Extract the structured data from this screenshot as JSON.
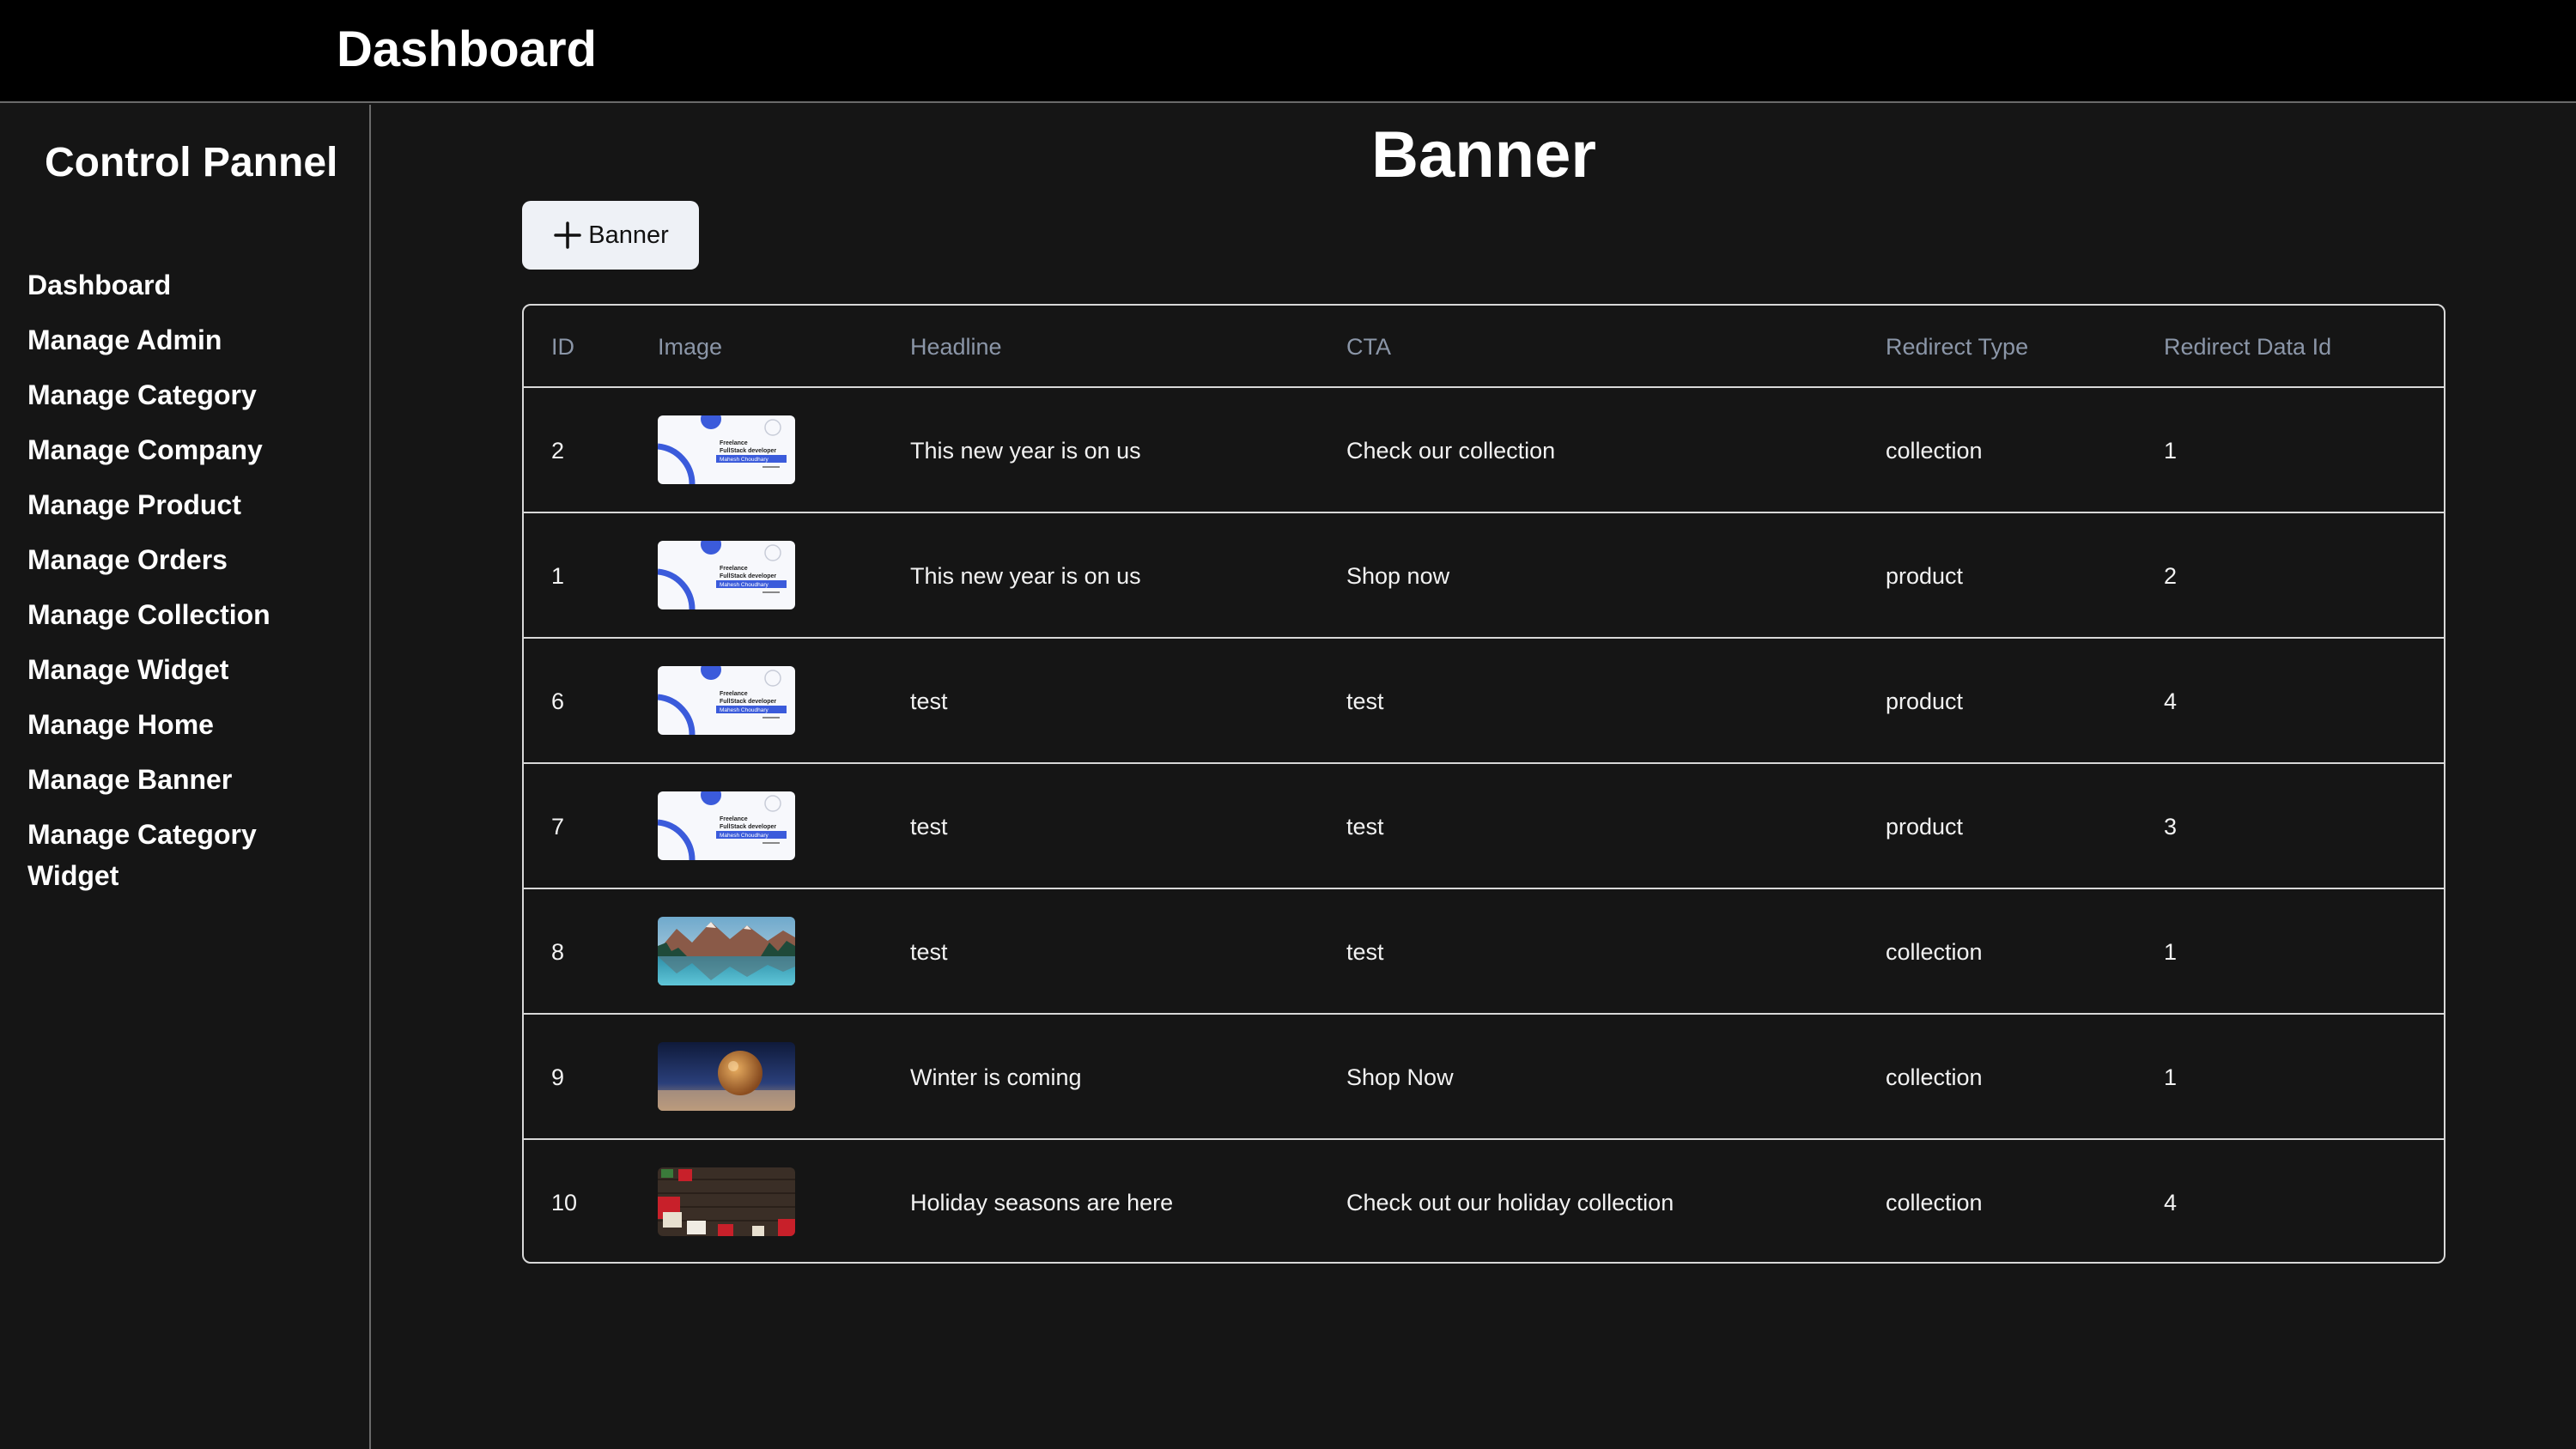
{
  "header": {
    "title": "Dashboard"
  },
  "sidebar": {
    "heading": "Control Pannel",
    "items": [
      {
        "label": "Dashboard"
      },
      {
        "label": "Manage Admin"
      },
      {
        "label": "Manage Category"
      },
      {
        "label": "Manage Company"
      },
      {
        "label": "Manage Product"
      },
      {
        "label": "Manage Orders"
      },
      {
        "label": "Manage Collection"
      },
      {
        "label": "Manage Widget"
      },
      {
        "label": "Manage Home"
      },
      {
        "label": "Manage Banner"
      },
      {
        "label": "Manage Category Widget"
      }
    ]
  },
  "main": {
    "title": "Banner",
    "add_button_label": "Banner",
    "add_button_icon": "plus-icon"
  },
  "table": {
    "columns": [
      "ID",
      "Image",
      "Headline",
      "CTA",
      "Redirect Type",
      "Redirect Data Id"
    ],
    "rows": [
      {
        "id": "2",
        "image": "resume-card",
        "headline": "This new year is on us",
        "cta": "Check our collection",
        "redirect_type": "collection",
        "redirect_data_id": "1"
      },
      {
        "id": "1",
        "image": "resume-card",
        "headline": "This new year is on us",
        "cta": "Shop now",
        "redirect_type": "product",
        "redirect_data_id": "2"
      },
      {
        "id": "6",
        "image": "resume-card",
        "headline": "test",
        "cta": "test",
        "redirect_type": "product",
        "redirect_data_id": "4"
      },
      {
        "id": "7",
        "image": "resume-card",
        "headline": "test",
        "cta": "test",
        "redirect_type": "product",
        "redirect_data_id": "3"
      },
      {
        "id": "8",
        "image": "mountain-lake",
        "headline": "test",
        "cta": "test",
        "redirect_type": "collection",
        "redirect_data_id": "1"
      },
      {
        "id": "9",
        "image": "winter-bubble",
        "headline": "Winter is coming",
        "cta": "Shop Now",
        "redirect_type": "collection",
        "redirect_data_id": "1"
      },
      {
        "id": "10",
        "image": "holiday-gifts",
        "headline": "Holiday seasons are here",
        "cta": "Check out our holiday collection",
        "redirect_type": "collection",
        "redirect_data_id": "4"
      }
    ]
  },
  "thumb_card": {
    "line1": "Freelance",
    "line2": "FullStack developer",
    "name": "Mahesh Choudhary"
  },
  "colors": {
    "background": "#151515",
    "topbar": "#000000",
    "border": "#d8d8d8",
    "header_text": "#8b96a8",
    "button_bg": "#eef1f6",
    "accent_blue": "#3b5bdb"
  }
}
